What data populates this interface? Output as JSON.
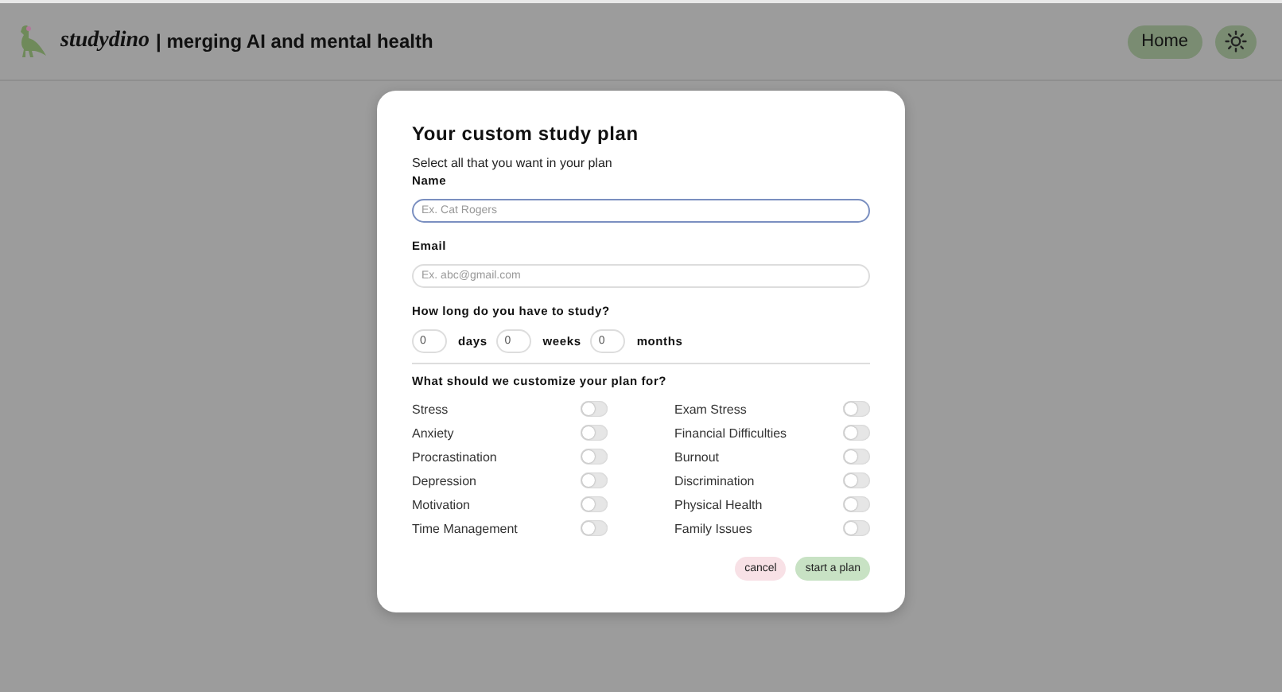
{
  "header": {
    "brand": "studydino",
    "tagline": "| merging AI and mental health",
    "nav": [
      {
        "label": "Home",
        "kind": "text"
      },
      {
        "kind": "theme"
      }
    ]
  },
  "dialog": {
    "title": "Your custom study plan",
    "subtitle": "Select all that you want in your plan",
    "fields": [
      {
        "label": "Name",
        "placeholder": "Ex. Cat Rogers",
        "focused": true
      },
      {
        "label": "Email",
        "placeholder": "Ex. abc@gmail.com",
        "focused": false
      }
    ],
    "duration": {
      "label": "How long do you have to study?",
      "units": [
        {
          "value": "0",
          "unit": "days"
        },
        {
          "value": "0",
          "unit": "weeks"
        },
        {
          "value": "0",
          "unit": "months"
        }
      ]
    },
    "options_heading": "What should we customize your plan for?",
    "options": [
      {
        "label": "Stress",
        "on": false
      },
      {
        "label": "Exam Stress",
        "on": false
      },
      {
        "label": "Anxiety",
        "on": false
      },
      {
        "label": "Financial Difficulties",
        "on": false
      },
      {
        "label": "Procrastination",
        "on": false
      },
      {
        "label": "Burnout",
        "on": false
      },
      {
        "label": "Depression",
        "on": false
      },
      {
        "label": "Discrimination",
        "on": false
      },
      {
        "label": "Motivation",
        "on": false
      },
      {
        "label": "Physical Health",
        "on": false
      },
      {
        "label": "Time Management",
        "on": false
      },
      {
        "label": "Family Issues",
        "on": false
      }
    ],
    "buttons": [
      {
        "label": "cancel",
        "kind": "cancel"
      },
      {
        "label": "start a plan",
        "kind": "primary"
      }
    ]
  }
}
